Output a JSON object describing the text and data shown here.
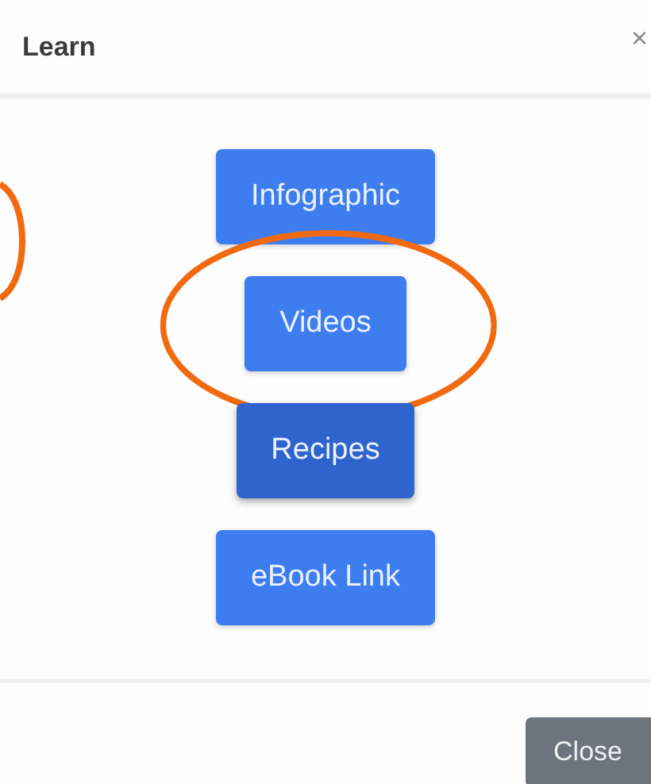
{
  "dialog": {
    "title": "Learn",
    "close_icon": "×"
  },
  "buttons": [
    {
      "label": "Infographic",
      "pressed": false,
      "circled": false
    },
    {
      "label": "Videos",
      "pressed": false,
      "circled": true
    },
    {
      "label": "Recipes",
      "pressed": true,
      "circled": false
    },
    {
      "label": "eBook Link",
      "pressed": false,
      "circled": false
    }
  ],
  "annotations": [
    {
      "kind": "edge-ellipse"
    }
  ],
  "footer": {
    "close_button": "Close"
  }
}
